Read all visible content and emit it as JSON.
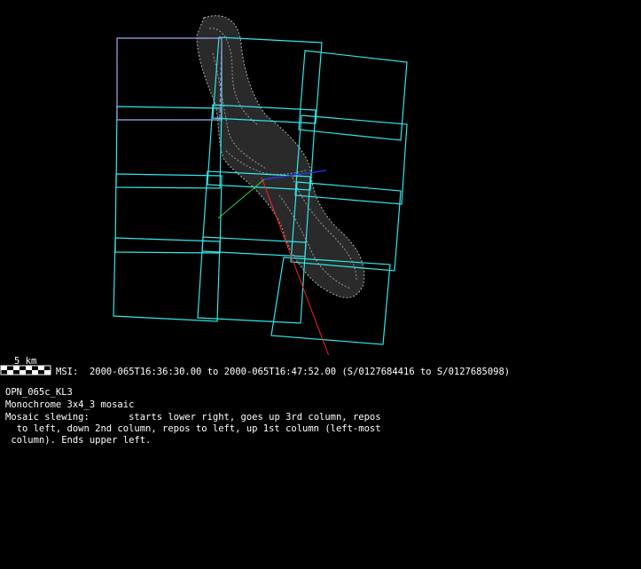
{
  "scale": {
    "label": "5 km"
  },
  "msi": {
    "label": "MSI:",
    "start_time": "2000-065T16:36:30.00",
    "to_word": "to",
    "end_time": "2000-065T16:47:52.00",
    "met_range": "(S/0127684416 to S/0127685098)"
  },
  "observation": {
    "id": "OPN_065c_KL3",
    "type": "Monochrome 3x4_3 mosaic",
    "slew_label": "Mosaic slewing:",
    "slew_text_1": "starts lower right, goes up 3rd column, repos",
    "slew_text_2": "  to left, down 2nd column, repos to left, up 1st column (left-most",
    "slew_text_3": " column). Ends upper left."
  },
  "colors": {
    "background": "#000000",
    "frame": "#33e6e6",
    "highlight_frame": "#d26cd2",
    "asteroid_mesh": "#a0a0a0",
    "sun_vector": "#ff2020",
    "axis_blue": "#2040ff",
    "axis_green": "#40d040",
    "text": "#ffffff"
  }
}
